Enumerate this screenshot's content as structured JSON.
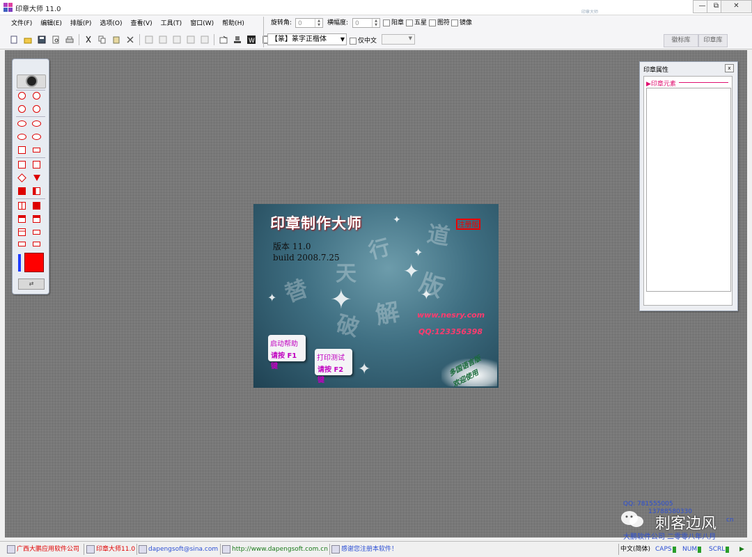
{
  "window": {
    "title": "印章大师 11.0",
    "app_icon_text": "印章\n大师",
    "background_ghost_text": "印章大师"
  },
  "window_controls": {
    "minimize": "—",
    "restore": "⧉",
    "close": "✕"
  },
  "menubar": {
    "items": [
      "文件(F)",
      "编辑(E)",
      "排版(P)",
      "选项(O)",
      "查看(V)",
      "工具(T)",
      "窗口(W)",
      "帮助(H)"
    ]
  },
  "controls": {
    "rotation_label": "旋转角:",
    "rotation_value": "0",
    "skew_label": "横幅度:",
    "skew_value": "0",
    "checkboxes": [
      "阳章",
      "五星",
      "图符",
      "镜像"
    ],
    "font_value": "【篆】篆字正楷体",
    "chinese_only_label": "仅中文"
  },
  "library_tabs": [
    "徽标库",
    "印章库"
  ],
  "splash": {
    "title": "印章制作大师",
    "stamp_text": "注册版",
    "version_line": "版本 11.0",
    "build_line": "build 2008.7.25",
    "url": "www.nesry.com",
    "qq": "QQ:123356398",
    "help_badge": {
      "line1": "启动帮助",
      "line2": "请按 F1 键"
    },
    "print_badge": {
      "line1": "打印测试",
      "line2": "请按 F2 键"
    },
    "lang_line1": "多国语言版",
    "lang_line2": "欢迎使用",
    "calligraphy": [
      "道",
      "行",
      "天",
      "替",
      "破",
      "解",
      "版"
    ]
  },
  "properties_panel": {
    "title": "印章属性",
    "close": "x",
    "section": "▶印章元素"
  },
  "watermark": {
    "qq1": "QQ:  781555005",
    "qq2": "13788580330",
    "email_partial": "cn",
    "company": "大鹏软件公司 二零零八年八月",
    "account_name": "刺客边风"
  },
  "statusbar": {
    "company": "广西大鹏应用软件公司",
    "product": "印章大师11.0",
    "email": "dapengsoft@sina.com",
    "website": "http://www.dapengsoft.com.cn",
    "thanks": "感谢您注册本软件！",
    "ime": "中文(简体)",
    "caps": "CAPS",
    "num": "NUM",
    "scrl": "SCRL"
  },
  "colors": {
    "accent_red": "#ff0000",
    "status_red": "#e00000",
    "link_blue": "#2c4fd4",
    "magenta": "#e01070"
  }
}
